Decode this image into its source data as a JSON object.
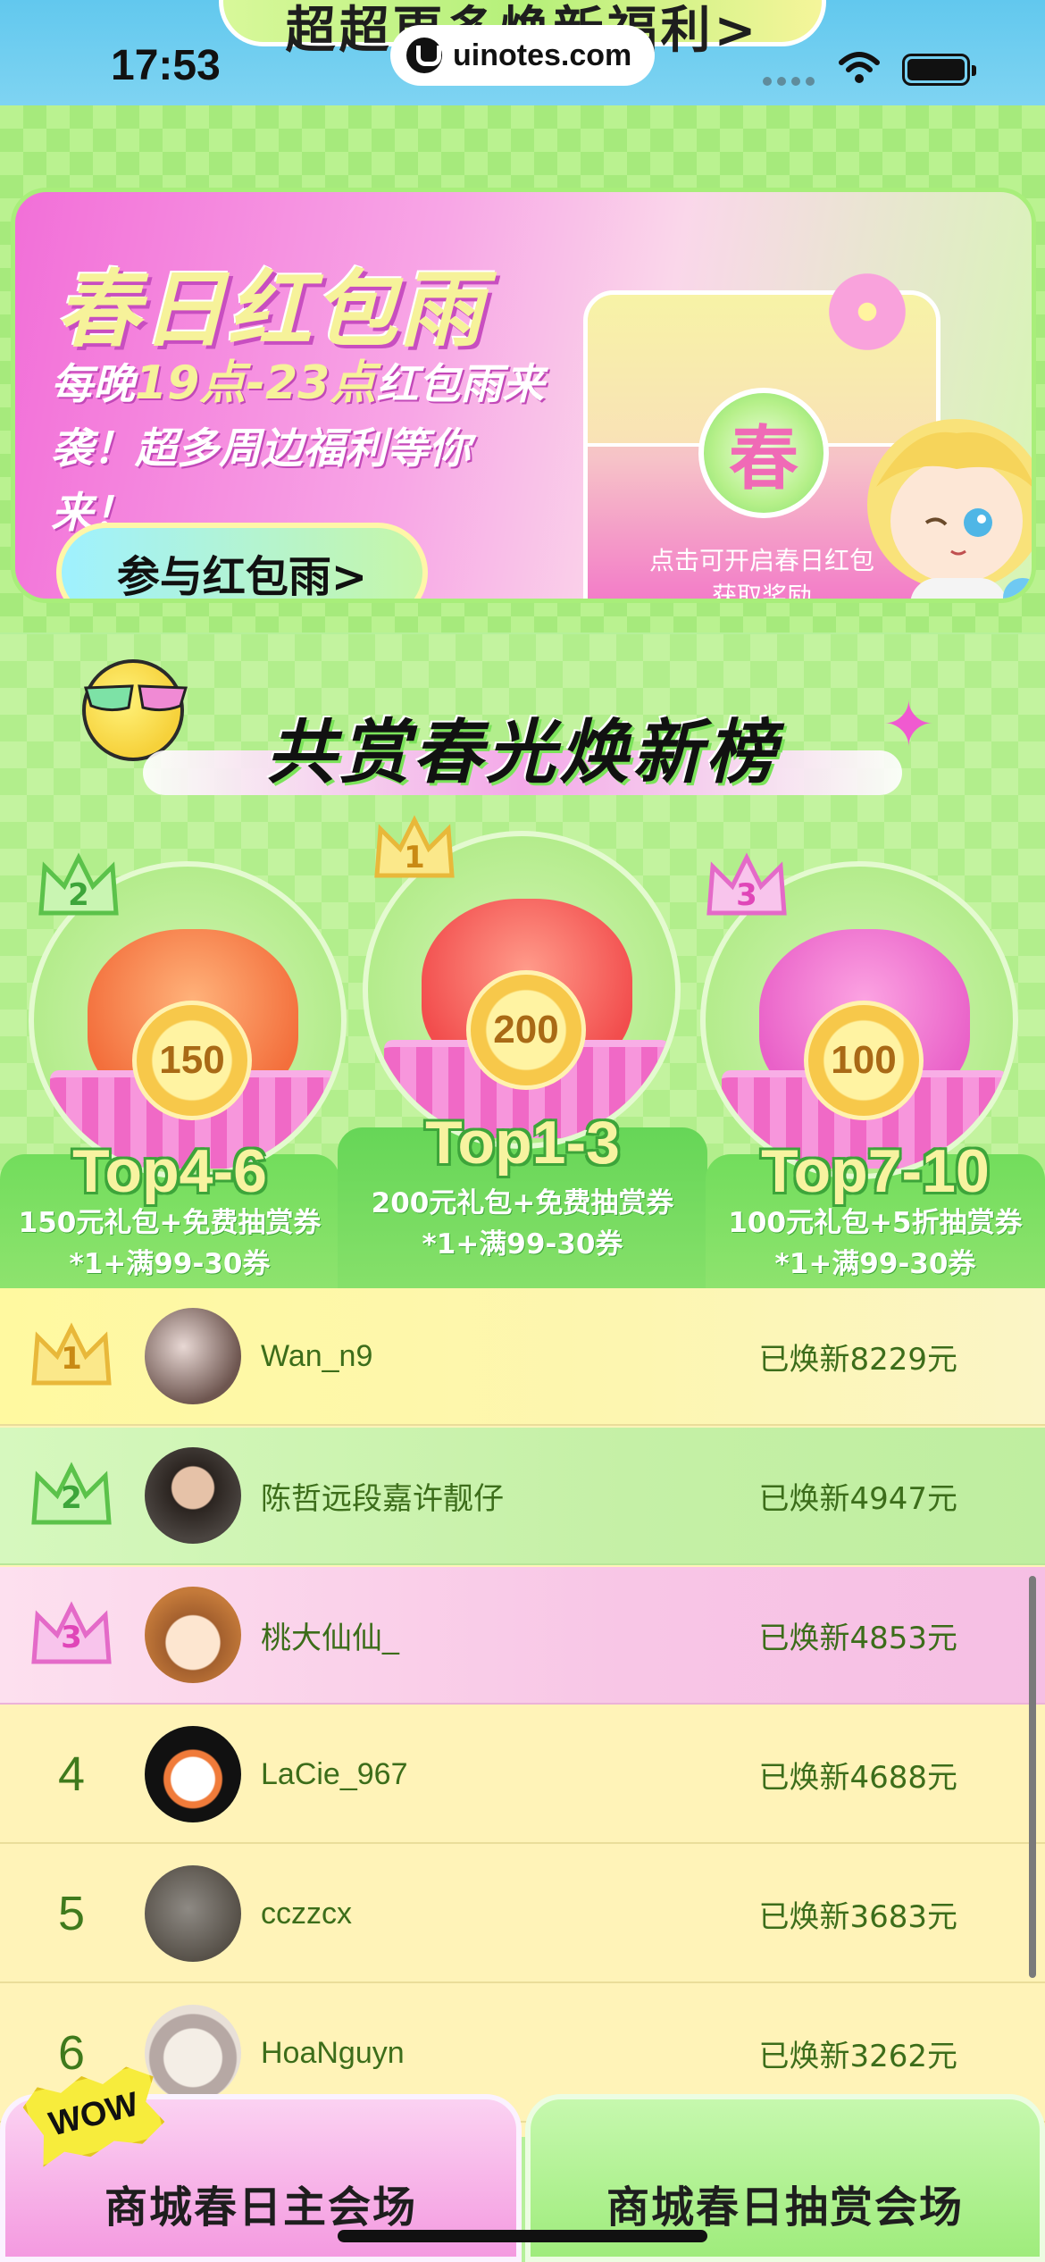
{
  "status_bar": {
    "time": "17:53",
    "url": "uinotes.com"
  },
  "top_banner_partial": "超超更多焕新福利>",
  "spring_banner": {
    "title": "春日红包雨",
    "desc_pre": "每晚",
    "desc_highlight": "19点-23点",
    "desc_post": "红包雨来袭！超多周边福利等你来！",
    "join_button": "参与红包雨>",
    "envelope_seal": "春",
    "envelope_text_1": "点击可开启春日红包",
    "envelope_text_2": "获取奖励"
  },
  "ranking": {
    "title": "共赏春光焕新榜",
    "tiers": [
      {
        "crown": "2",
        "label": "Top4-6",
        "coin": "150",
        "desc_1": "150元礼包+免费抽赏券",
        "desc_2": "*1+满99-30券"
      },
      {
        "crown": "1",
        "label": "Top1-3",
        "coin": "200",
        "desc_1": "200元礼包+免费抽赏券",
        "desc_2": "*1+满99-30券"
      },
      {
        "crown": "3",
        "label": "Top7-10",
        "coin": "100",
        "desc_1": "100元礼包+5折抽赏券",
        "desc_2": "*1+满99-30券"
      }
    ]
  },
  "leaderboard": [
    {
      "rank": "1",
      "name": "Wan_n9",
      "amount": "已焕新8229元"
    },
    {
      "rank": "2",
      "name": "陈哲远段嘉许靓仔",
      "amount": "已焕新4947元"
    },
    {
      "rank": "3",
      "name": "桃大仙仙_",
      "amount": "已焕新4853元"
    },
    {
      "rank": "4",
      "name": "LaCie_967",
      "amount": "已焕新4688元"
    },
    {
      "rank": "5",
      "name": "cczzcx",
      "amount": "已焕新3683元"
    },
    {
      "rank": "6",
      "name": "HoaNguyn",
      "amount": "已焕新3262元"
    }
  ],
  "bottom": {
    "badge": "WOW",
    "left_button": "商城春日主会场",
    "right_button": "商城春日抽赏会场"
  },
  "colors": {
    "brand_green": "#8ee36e",
    "brand_pink": "#f26fd8",
    "text_green": "#3c6d1a",
    "gold": "#f7c84a"
  },
  "icons": [
    "site-logo-icon",
    "wifi-icon",
    "battery-icon",
    "flower-icon",
    "sun-sunglasses-icon",
    "sparkle-icon",
    "crown-icon",
    "bow-icon"
  ]
}
